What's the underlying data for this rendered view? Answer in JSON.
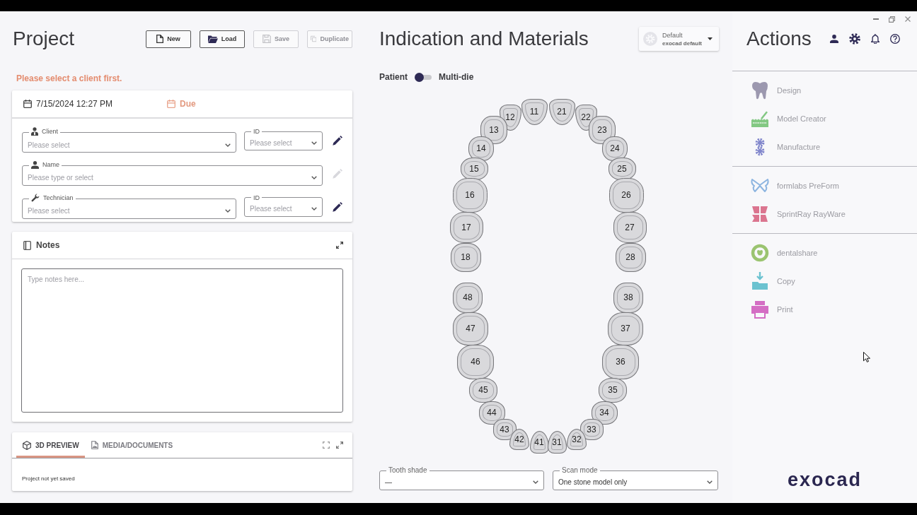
{
  "project": {
    "title": "Project",
    "buttons": [
      {
        "label": "New",
        "disabled": false
      },
      {
        "label": "Load",
        "disabled": false
      },
      {
        "label": "Save",
        "disabled": true
      },
      {
        "label": "Duplicate",
        "disabled": true
      }
    ],
    "warning": "Please select a client first.",
    "details": {
      "date": "7/15/2024 12:27 PM",
      "due": "Due",
      "rows": [
        {
          "fields": [
            {
              "label": "Client",
              "placeholder": "Please select"
            },
            {
              "label": "ID",
              "placeholder": "Please select"
            }
          ],
          "edit_disabled": false
        },
        {
          "fields": [
            {
              "label": "Name",
              "placeholder": "Please type or select"
            }
          ],
          "edit_disabled": true
        },
        {
          "fields": [
            {
              "label": "Technician",
              "placeholder": "Please select"
            },
            {
              "label": "ID",
              "placeholder": "Please select"
            }
          ],
          "edit_disabled": false
        }
      ]
    },
    "notes": {
      "title": "Notes",
      "placeholder": "Type notes here..."
    },
    "preview": {
      "tabs": [
        {
          "label": "3D PREVIEW",
          "selected": true
        },
        {
          "label": "MEDIA/DOCUMENTS",
          "selected": false
        }
      ],
      "status": "Project not yet saved"
    }
  },
  "indication": {
    "title": "Indication and Materials",
    "preset": {
      "name": "Default",
      "subtitle": "exocad default"
    },
    "mode": {
      "left": "Patient",
      "right": "Multi-die",
      "on": false
    },
    "tooth_chart": {
      "teeth": [
        "11",
        "21",
        "12",
        "22",
        "13",
        "23",
        "14",
        "24",
        "15",
        "25",
        "16",
        "26",
        "17",
        "27",
        "18",
        "28",
        "48",
        "38",
        "47",
        "37",
        "46",
        "36",
        "45",
        "35",
        "44",
        "34",
        "43",
        "33",
        "42",
        "32",
        "41",
        "31"
      ]
    },
    "fields": [
      {
        "label": "Tooth shade",
        "value": "—"
      },
      {
        "label": "Scan mode",
        "value": "One stone model only"
      }
    ]
  },
  "actions": {
    "title": "Actions",
    "groups": [
      [
        {
          "label": "Design",
          "disabled": true
        },
        {
          "label": "Model Creator",
          "disabled": true
        },
        {
          "label": "Manufacture",
          "disabled": true
        }
      ],
      [
        {
          "label": "formlabs PreForm",
          "disabled": true
        },
        {
          "label": "SprintRay RayWare",
          "disabled": true
        }
      ],
      [
        {
          "label": "dentalshare",
          "disabled": true
        },
        {
          "label": "Copy",
          "disabled": true
        },
        {
          "label": "Print",
          "disabled": true
        }
      ]
    ]
  },
  "logo": "exocad"
}
